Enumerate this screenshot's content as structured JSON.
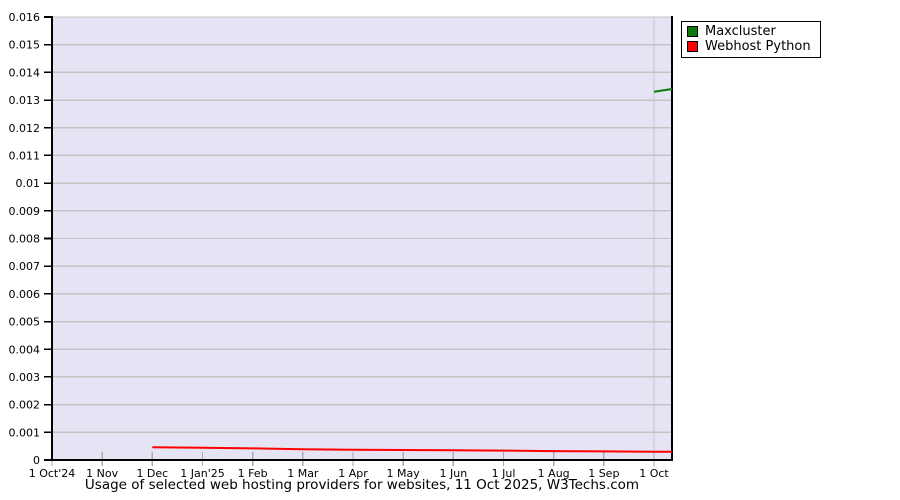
{
  "chart_data": {
    "type": "line",
    "title": "Usage of selected web hosting providers for websites, 11 Oct 2025, W3Techs.com",
    "x_unit": "months since 1 Oct 2024",
    "x_domain": [
      0,
      12.36
    ],
    "y_domain": [
      0,
      0.016
    ],
    "ylabel": "",
    "xlabel": "",
    "grid": {
      "horizontal_step": 0.001,
      "vertical_gridline_x": 12
    },
    "legend_position": "top-right",
    "colors": {
      "plot_background": "#e4e4f4",
      "grid_line": "#c4c4c4",
      "axis": "#000000",
      "x_tick": "#aaaaaa"
    },
    "x_ticks": [
      {
        "x": 0,
        "label": "1 Oct'24"
      },
      {
        "x": 1,
        "label": "1 Nov"
      },
      {
        "x": 2,
        "label": "1 Dec"
      },
      {
        "x": 3,
        "label": "1 Jan'25"
      },
      {
        "x": 4,
        "label": "1 Feb"
      },
      {
        "x": 5,
        "label": "1 Mar"
      },
      {
        "x": 6,
        "label": "1 Apr"
      },
      {
        "x": 7,
        "label": "1 May"
      },
      {
        "x": 8,
        "label": "1 Jun"
      },
      {
        "x": 9,
        "label": "1 Jul"
      },
      {
        "x": 10,
        "label": "1 Aug"
      },
      {
        "x": 11,
        "label": "1 Sep"
      },
      {
        "x": 12,
        "label": "1 Oct"
      }
    ],
    "y_ticks": [
      {
        "v": 0.016,
        "label": "0.016"
      },
      {
        "v": 0.015,
        "label": "0.015"
      },
      {
        "v": 0.014,
        "label": "0.014"
      },
      {
        "v": 0.013,
        "label": "0.013"
      },
      {
        "v": 0.012,
        "label": "0.012"
      },
      {
        "v": 0.011,
        "label": "0.011"
      },
      {
        "v": 0.01,
        "label": "0.01"
      },
      {
        "v": 0.009,
        "label": "0.009"
      },
      {
        "v": 0.008,
        "label": "0.008"
      },
      {
        "v": 0.007,
        "label": "0.007"
      },
      {
        "v": 0.006,
        "label": "0.006"
      },
      {
        "v": 0.005,
        "label": "0.005"
      },
      {
        "v": 0.004,
        "label": "0.004"
      },
      {
        "v": 0.003,
        "label": "0.003"
      },
      {
        "v": 0.002,
        "label": "0.002"
      },
      {
        "v": 0.001,
        "label": "0.001"
      },
      {
        "v": 0,
        "label": "0"
      }
    ],
    "series": [
      {
        "name": "Maxcluster",
        "color": "#0a7a0a",
        "points": [
          [
            12,
            0.0133
          ],
          [
            12.36,
            0.0134
          ]
        ]
      },
      {
        "name": "Webhost Python",
        "color": "#ff0000",
        "points": [
          [
            2,
            0.00046
          ],
          [
            3,
            0.00044
          ],
          [
            4,
            0.00042
          ],
          [
            5,
            0.00039
          ],
          [
            6,
            0.00037
          ],
          [
            7,
            0.00036
          ],
          [
            8,
            0.00035
          ],
          [
            9,
            0.00034
          ],
          [
            10,
            0.00032
          ],
          [
            11,
            0.00031
          ],
          [
            12,
            0.0003
          ],
          [
            12.36,
            0.0003
          ]
        ]
      }
    ]
  }
}
